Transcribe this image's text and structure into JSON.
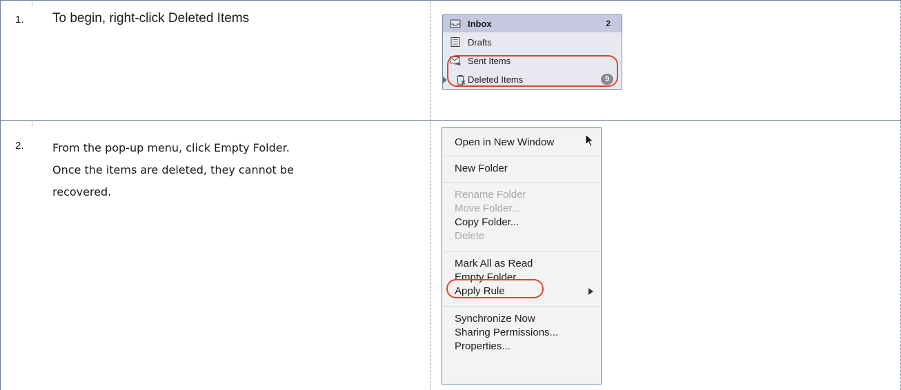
{
  "steps": [
    {
      "number": "1.",
      "text": "To begin, right-click Deleted Items"
    },
    {
      "number": "2.",
      "lines": [
        "From the pop-up menu, click Empty Folder.",
        "Once the items are deleted, they cannot be",
        "recovered."
      ]
    }
  ],
  "folder_pane": {
    "items": [
      {
        "label": "Inbox",
        "count": "2",
        "icon": "inbox-icon",
        "selected": true
      },
      {
        "label": "Drafts",
        "icon": "drafts-icon"
      },
      {
        "label": "Sent Items",
        "icon": "sent-items-icon"
      },
      {
        "label": "Deleted Items",
        "badge": "9",
        "icon": "trash-icon"
      }
    ]
  },
  "context_menu": {
    "groups": [
      [
        {
          "label": "Open in New Window",
          "enabled": true
        }
      ],
      [
        {
          "label": "New Folder",
          "enabled": true
        }
      ],
      [
        {
          "label": "Rename Folder",
          "enabled": false
        },
        {
          "label": "Move Folder...",
          "enabled": false
        },
        {
          "label": "Copy Folder...",
          "enabled": true
        },
        {
          "label": "Delete",
          "enabled": false
        }
      ],
      [
        {
          "label": "Mark All as Read",
          "enabled": true
        },
        {
          "label": "Empty Folder",
          "enabled": true
        },
        {
          "label": "Apply Rule",
          "enabled": true,
          "submenu": true
        }
      ],
      [
        {
          "label": "Synchronize Now",
          "enabled": true
        },
        {
          "label": "Sharing Permissions...",
          "enabled": true
        },
        {
          "label": "Properties...",
          "enabled": true
        }
      ]
    ]
  },
  "colors": {
    "highlight": "#e0442b",
    "menu_border": "#5b84c4",
    "selected_row": "#c5c8df",
    "disabled_text": "#a9a9a9"
  }
}
